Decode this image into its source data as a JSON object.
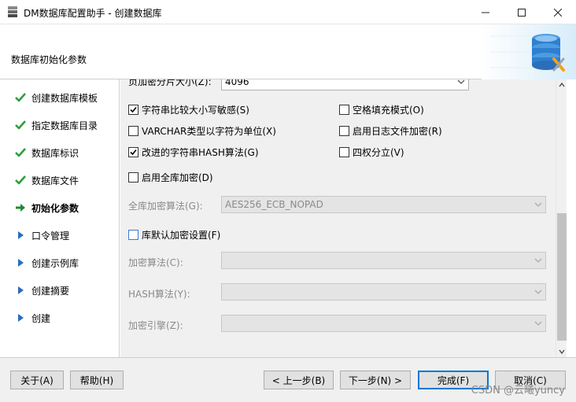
{
  "window": {
    "title": "DM数据库配置助手 - 创建数据库"
  },
  "header": {
    "title": "数据库初始化参数"
  },
  "sidebar": {
    "items": [
      {
        "label": "创建数据库模板",
        "state": "done"
      },
      {
        "label": "指定数据库目录",
        "state": "done"
      },
      {
        "label": "数据库标识",
        "state": "done"
      },
      {
        "label": "数据库文件",
        "state": "done"
      },
      {
        "label": "初始化参数",
        "state": "current"
      },
      {
        "label": "口令管理",
        "state": "pending"
      },
      {
        "label": "创建示例库",
        "state": "pending"
      },
      {
        "label": "创建摘要",
        "state": "pending"
      },
      {
        "label": "创建",
        "state": "pending"
      }
    ]
  },
  "form": {
    "page_size_label": "页加密分片大小(Z):",
    "page_size_value": "4096",
    "checkboxes": [
      {
        "label": "字符串比较大小写敏感(S)",
        "checked": true
      },
      {
        "label": "空格填充模式(O)",
        "checked": false
      },
      {
        "label": "VARCHAR类型以字符为单位(X)",
        "checked": false
      },
      {
        "label": "启用日志文件加密(R)",
        "checked": false
      },
      {
        "label": "改进的字符串HASH算法(G)",
        "checked": true
      },
      {
        "label": "四权分立(V)",
        "checked": false
      },
      {
        "label": "启用全库加密(D)",
        "checked": false
      }
    ],
    "full_encrypt_algo_label": "全库加密算法(G):",
    "full_encrypt_algo_value": "AES256_ECB_NOPAD",
    "default_encrypt_label": "库默认加密设置(F)",
    "default_encrypt_checked": false,
    "encrypt_algo_label": "加密算法(C):",
    "hash_algo_label": "HASH算法(Y):",
    "encrypt_engine_label": "加密引擎(Z):"
  },
  "footer": {
    "about": "关于(A)",
    "help": "帮助(H)",
    "back": "< 上一步(B)",
    "next": "下一步(N) >",
    "finish": "完成(F)",
    "cancel": "取消(C)",
    "watermark": "CSDN @云曦yuncy"
  },
  "colors": {
    "check_green": "#2e9e3e",
    "arrow_green": "#1f8a2f",
    "pending_blue": "#2a6dbf",
    "focus_blue": "#0078d7"
  }
}
